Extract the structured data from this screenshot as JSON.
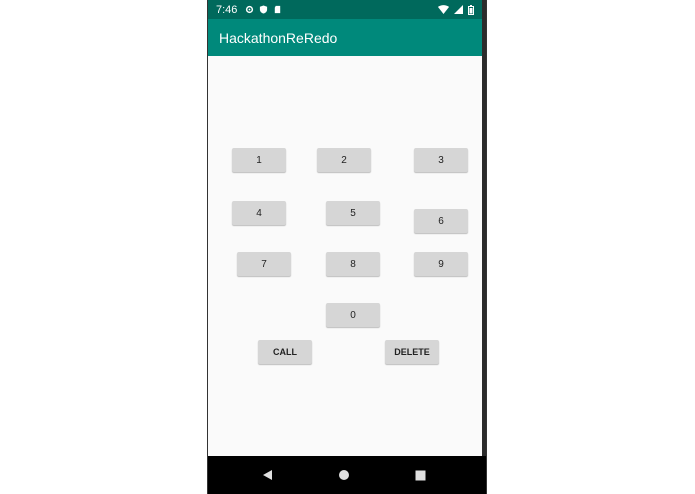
{
  "status_bar": {
    "time": "7:46",
    "left_icons": [
      "gear-icon",
      "shield-icon",
      "sd-card-icon"
    ],
    "right_icons": [
      "wifi-icon",
      "signal-icon",
      "battery-icon"
    ]
  },
  "app_bar": {
    "title": "HackathonReRedo"
  },
  "keypad": {
    "k1": "1",
    "k2": "2",
    "k3": "3",
    "k4": "4",
    "k5": "5",
    "k6": "6",
    "k7": "7",
    "k8": "8",
    "k9": "9",
    "k0": "0"
  },
  "actions": {
    "call": "CALL",
    "delete": "DELETE"
  },
  "nav_bar": {
    "icons": [
      "back-icon",
      "home-icon",
      "recents-icon"
    ]
  },
  "colors": {
    "status_bar": "#00695c",
    "app_bar": "#00897b",
    "button": "#d6d6d6",
    "background": "#fafafa"
  }
}
